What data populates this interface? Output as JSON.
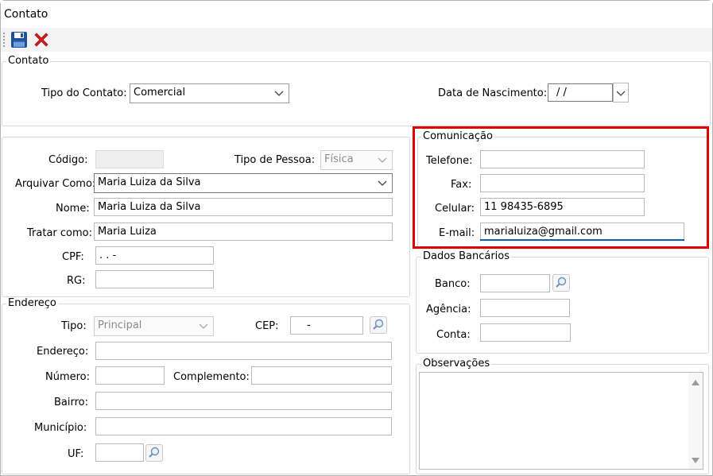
{
  "window": {
    "title": "Contato"
  },
  "toolbar": {
    "save_icon": "save-icon",
    "close_icon": "close-icon"
  },
  "contato": {
    "legend": "Contato",
    "tipo_label": "Tipo do Contato:",
    "tipo_value": "Comercial",
    "nascimento_label": "Data de Nascimento:",
    "nascimento_value": " /  /"
  },
  "dados": {
    "codigo_label": "Código:",
    "codigo_value": "",
    "tipo_pessoa_label": "Tipo de Pessoa:",
    "tipo_pessoa_value": "Física",
    "arquivar_label": "Arquivar Como:",
    "arquivar_value": "Maria Luiza da Silva",
    "nome_label": "Nome:",
    "nome_value": "Maria Luiza da Silva",
    "tratar_label": "Tratar como:",
    "tratar_value": "Maria Luiza",
    "cpf_label": "CPF:",
    "cpf_value": "   .    .    -",
    "rg_label": "RG:",
    "rg_value": ""
  },
  "endereco": {
    "legend": "Endereço",
    "tipo_label": "Tipo:",
    "tipo_value": "Principal",
    "cep_label": "CEP:",
    "cep_value": "-",
    "endereco_label": "Endereço:",
    "endereco_value": "",
    "numero_label": "Número:",
    "numero_value": "",
    "complemento_label": "Complemento:",
    "complemento_value": "",
    "bairro_label": "Bairro:",
    "bairro_value": "",
    "municipio_label": "Município:",
    "municipio_value": "",
    "uf_label": "UF:",
    "uf_value": ""
  },
  "comunicacao": {
    "legend": "Comunicação",
    "telefone_label": "Telefone:",
    "telefone_value": "",
    "fax_label": "Fax:",
    "fax_value": "",
    "celular_label": "Celular:",
    "celular_value": "11 98435-6895",
    "email_label": "E-mail:",
    "email_value": "marialuiza@gmail.com",
    "highlight_color": "#e00000"
  },
  "bancarios": {
    "legend": "Dados Bancários",
    "banco_label": "Banco:",
    "banco_value": "",
    "agencia_label": "Agência:",
    "agencia_value": "",
    "conta_label": "Conta:",
    "conta_value": ""
  },
  "observacoes": {
    "legend": "Observações",
    "value": ""
  },
  "colors": {
    "accent": "#0a5fb3",
    "close_red": "#d81e1e"
  }
}
